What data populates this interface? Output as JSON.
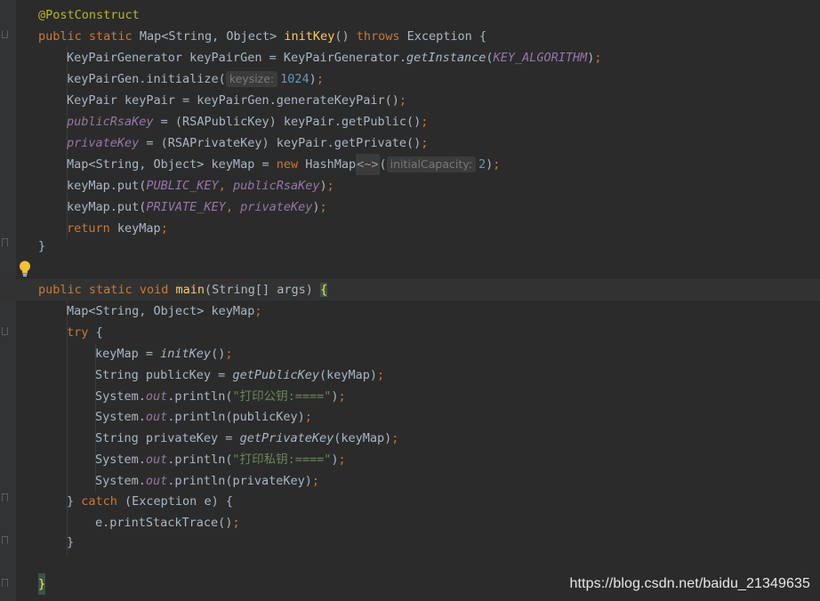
{
  "editor": {
    "language": "java",
    "colors": {
      "background": "#2b2b2b",
      "keyword": "#cc7832",
      "annotation": "#bbb529",
      "method": "#ffc66d",
      "field": "#9876aa",
      "number": "#6897bb",
      "string": "#6a8759",
      "text": "#a9b7c6"
    },
    "code": {
      "annotation": "@PostConstruct",
      "init_key_sig": {
        "kw1": "public",
        "kw2": "static",
        "type": "Map<String, Object>",
        "name": "initKey",
        "params": "()",
        "kw3": "throws",
        "exc": "Exception",
        "open": "{"
      },
      "gen_line": {
        "a": "KeyPairGenerator keyPairGen = KeyPairGenerator.",
        "method": "getInstance",
        "paren": "(",
        "const": "KEY_ALGORITHM",
        "close": ")"
      },
      "init_line": {
        "a": "keyPairGen.initialize(",
        "hint": "keysize:",
        "value": "1024",
        "close": ")"
      },
      "pair_line": {
        "a": "KeyPair keyPair = keyPairGen.generateKeyPair()"
      },
      "pub_line": {
        "field": "publicRsaKey",
        "rest": " = (RSAPublicKey) keyPair.getPublic()"
      },
      "priv_line": {
        "field": "privateKey",
        "rest": " = (RSAPrivateKey) keyPair.getPrivate()"
      },
      "map_line": {
        "a": "Map<String, Object> keyMap = ",
        "kw": "new",
        "b": " HashMap",
        "diamond": "<~>",
        "paren": "(",
        "hint": "initialCapacity:",
        "value": "2",
        "close": ")"
      },
      "put1_line": {
        "a": "keyMap.put(",
        "const": "PUBLIC_KEY",
        "comma": ", ",
        "field": "publicRsaKey",
        "close": ")"
      },
      "put2_line": {
        "a": "keyMap.put(",
        "const": "PRIVATE_KEY",
        "comma": ", ",
        "field": "privateKey",
        "close": ")"
      },
      "return_line": {
        "kw": "return",
        "rest": " keyMap"
      },
      "close_brace": "}",
      "main_sig": {
        "kw1": "public",
        "kw2": "static",
        "kw3": "void",
        "name": "main",
        "params": "(String[] args) ",
        "open": "{"
      },
      "decl_line": {
        "a": "Map<String, Object> keyMap"
      },
      "try_line": {
        "kw": "try",
        "rest": " {"
      },
      "t1": {
        "a": "keyMap = ",
        "method": "initKey",
        "rest": "()"
      },
      "t2": {
        "a": "String publicKey = ",
        "method": "getPublicKey",
        "rest": "(keyMap)"
      },
      "t3": {
        "a": "System.",
        "out": "out",
        "b": ".println(",
        "str": "\"打印公钥:====\"",
        "close": ")"
      },
      "t4": {
        "a": "System.",
        "out": "out",
        "b": ".println(publicKey)"
      },
      "t5": {
        "a": "String privateKey = ",
        "method": "getPrivateKey",
        "rest": "(keyMap)"
      },
      "t6": {
        "a": "System.",
        "out": "out",
        "b": ".println(",
        "str": "\"打印私钥:====\"",
        "close": ")"
      },
      "t7": {
        "a": "System.",
        "out": "out",
        "b": ".println(privateKey)"
      },
      "catch_line": {
        "a": "} ",
        "kw": "catch",
        "rest": " (Exception e) {"
      },
      "c1": {
        "a": "e.printStackTrace()"
      },
      "semicolon": ";"
    }
  },
  "watermark": "https://blog.csdn.net/baidu_21349635"
}
